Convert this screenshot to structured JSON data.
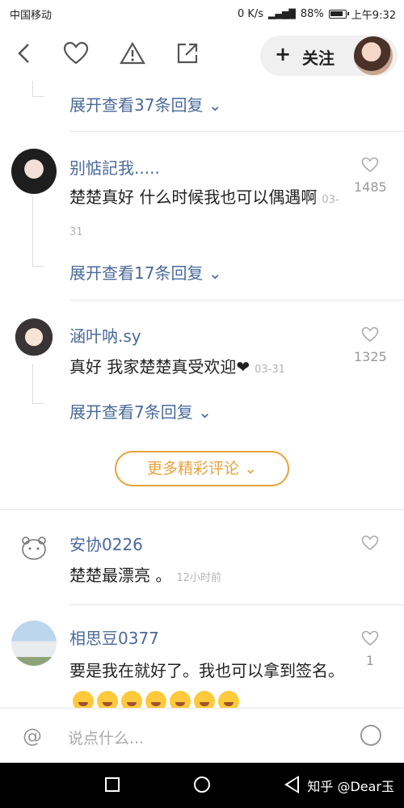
{
  "status_bar": {
    "carrier": "中国移动",
    "net_speed": "0 K/s",
    "battery": "88%",
    "time": "上午9:32"
  },
  "top_bar": {
    "follow_label": "关注"
  },
  "comments": [
    {
      "expand_label": "展开查看37条回复"
    },
    {
      "username": "别惦記我.....",
      "text": "楚楚真好  什么时候我也可以偶遇啊",
      "date": "03-31",
      "likes": "1485",
      "expand_label": "展开查看17条回复"
    },
    {
      "username": "涵叶呐.sy",
      "text": "真好 我家楚楚真受欢迎❤",
      "date": "03-31",
      "likes": "1325",
      "expand_label": "展开查看7条回复"
    }
  ],
  "more_comments_label": "更多精彩评论",
  "recent_comments": [
    {
      "username": "安协0226",
      "text": "楚楚最漂亮 。",
      "date": "12小时前"
    },
    {
      "username": "相思豆0377",
      "text": "要是我在就好了。我也可以拿到签名。",
      "likes": "1"
    }
  ],
  "input_bar": {
    "placeholder": "说点什么..."
  },
  "watermark": "知乎 @Dear玉",
  "colors": {
    "link_blue": "#4a6a9a",
    "accent_orange": "#e8a23a"
  }
}
